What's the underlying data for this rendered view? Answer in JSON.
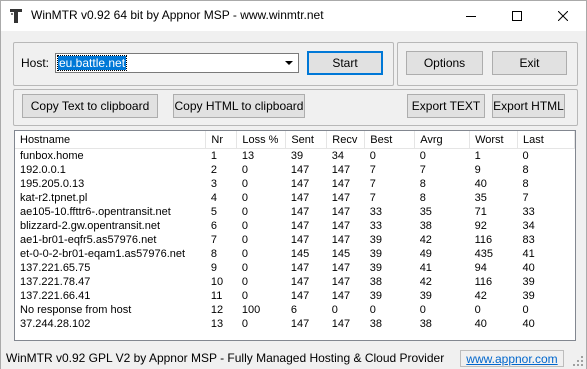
{
  "window": {
    "title": "WinMTR v0.92 64 bit by Appnor MSP - www.winmtr.net"
  },
  "host": {
    "label": "Host:",
    "value": "eu.battle.net"
  },
  "buttons": {
    "start": "Start",
    "options": "Options",
    "exit": "Exit",
    "copy_text": "Copy Text to clipboard",
    "copy_html": "Copy HTML to clipboard",
    "export_text": "Export TEXT",
    "export_html": "Export HTML"
  },
  "table": {
    "columns": [
      "Hostname",
      "Nr",
      "Loss %",
      "Sent",
      "Recv",
      "Best",
      "Avrg",
      "Worst",
      "Last"
    ],
    "rows": [
      [
        "funbox.home",
        "1",
        "13",
        "39",
        "34",
        "0",
        "0",
        "1",
        "0"
      ],
      [
        "192.0.0.1",
        "2",
        "0",
        "147",
        "147",
        "7",
        "7",
        "9",
        "8"
      ],
      [
        "195.205.0.13",
        "3",
        "0",
        "147",
        "147",
        "7",
        "8",
        "40",
        "8"
      ],
      [
        "kat-r2.tpnet.pl",
        "4",
        "0",
        "147",
        "147",
        "7",
        "8",
        "35",
        "7"
      ],
      [
        "ae105-10.ffttr6-.opentransit.net",
        "5",
        "0",
        "147",
        "147",
        "33",
        "35",
        "71",
        "33"
      ],
      [
        "blizzard-2.gw.opentransit.net",
        "6",
        "0",
        "147",
        "147",
        "33",
        "38",
        "92",
        "34"
      ],
      [
        "ae1-br01-eqfr5.as57976.net",
        "7",
        "0",
        "147",
        "147",
        "39",
        "42",
        "116",
        "83"
      ],
      [
        "et-0-0-2-br01-eqam1.as57976.net",
        "8",
        "0",
        "145",
        "145",
        "39",
        "49",
        "435",
        "41"
      ],
      [
        "137.221.65.75",
        "9",
        "0",
        "147",
        "147",
        "39",
        "41",
        "94",
        "40"
      ],
      [
        "137.221.78.47",
        "10",
        "0",
        "147",
        "147",
        "38",
        "42",
        "116",
        "39"
      ],
      [
        "137.221.66.41",
        "11",
        "0",
        "147",
        "147",
        "39",
        "39",
        "42",
        "39"
      ],
      [
        "No response from host",
        "12",
        "100",
        "6",
        "0",
        "0",
        "0",
        "0",
        "0"
      ],
      [
        "37.244.28.102",
        "13",
        "0",
        "147",
        "147",
        "38",
        "38",
        "40",
        "40"
      ]
    ]
  },
  "status": {
    "text": "WinMTR v0.92 GPL V2 by Appnor MSP - Fully Managed Hosting & Cloud Provider",
    "link": "www.appnor.com"
  }
}
